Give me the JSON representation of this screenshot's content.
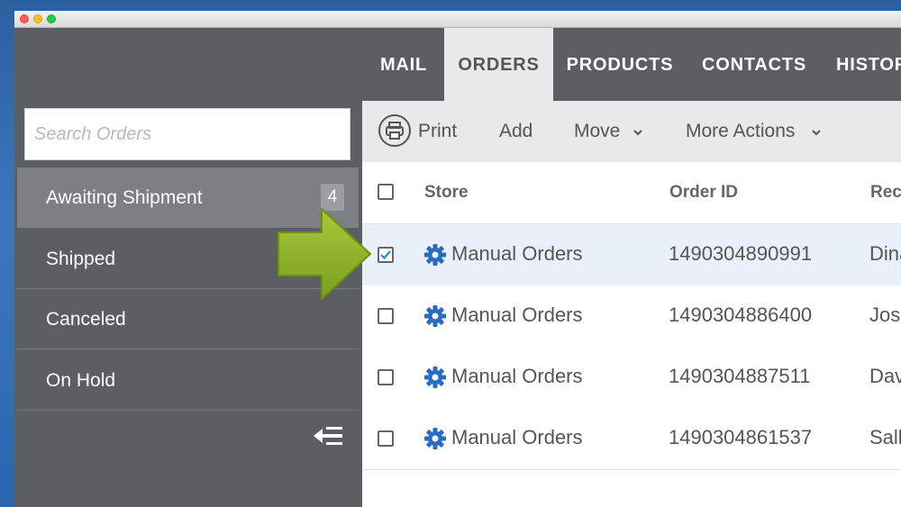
{
  "nav": {
    "tabs": [
      {
        "label": "MAIL",
        "active": false
      },
      {
        "label": "ORDERS",
        "active": true
      },
      {
        "label": "PRODUCTS",
        "active": false
      },
      {
        "label": "CONTACTS",
        "active": false
      },
      {
        "label": "HISTORY",
        "active": false
      }
    ]
  },
  "sidebar": {
    "search_placeholder": "Search Orders",
    "items": [
      {
        "label": "Awaiting Shipment",
        "badge": "4",
        "active": true
      },
      {
        "label": "Shipped",
        "active": false
      },
      {
        "label": "Canceled",
        "active": false
      },
      {
        "label": "On Hold",
        "active": false
      }
    ],
    "collapse_icon": "collapse-sidebar-icon"
  },
  "toolbar": {
    "print": "Print",
    "add": "Add",
    "move": "Move",
    "more_actions": "More Actions"
  },
  "table": {
    "headers": {
      "store": "Store",
      "order_id": "Order ID",
      "recipient": "Recipient"
    },
    "rows": [
      {
        "store": "Manual Orders",
        "order_id": "1490304890991",
        "recipient": "Dina",
        "checked": true
      },
      {
        "store": "Manual Orders",
        "order_id": "1490304886400",
        "recipient": "Jose",
        "checked": false
      },
      {
        "store": "Manual Orders",
        "order_id": "1490304887511",
        "recipient": "Dave",
        "checked": false
      },
      {
        "store": "Manual Orders",
        "order_id": "1490304861537",
        "recipient": "Sally",
        "checked": false
      }
    ]
  },
  "colors": {
    "accent": "#2a6dc0",
    "arrow": "#8db12a",
    "sidebar": "#5b5e62",
    "selected_row": "#eaf0f7"
  }
}
